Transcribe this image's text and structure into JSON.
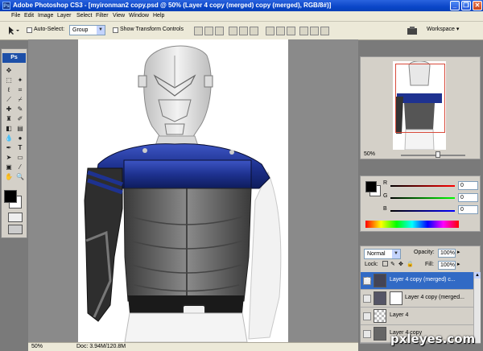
{
  "window": {
    "title": "Adobe Photoshop CS3 - [myironman2 copy.psd @ 50% (Layer 4 copy (merged) copy (merged), RGB/8#)]",
    "app_icon": "Ps",
    "minimize": "_",
    "restore": "❐",
    "close": "✕"
  },
  "menu": [
    "File",
    "Edit",
    "Image",
    "Layer",
    "Select",
    "Filter",
    "View",
    "Window",
    "Help"
  ],
  "options": {
    "auto_select_label": "Auto-Select:",
    "auto_select_value": "Group",
    "transform_label": "Show Transform Controls",
    "workspace_label": "Workspace ▾"
  },
  "toolbox": {
    "logo": "Ps",
    "icons": [
      "move-icon",
      "marquee-icon",
      "lasso-icon",
      "magic-wand-icon",
      "crop-icon",
      "slice-icon",
      "healing-icon",
      "brush-icon",
      "stamp-icon",
      "history-brush-icon",
      "eraser-icon",
      "gradient-icon",
      "blur-icon",
      "dodge-icon",
      "pen-icon",
      "type-icon",
      "path-select-icon",
      "shape-icon",
      "notes-icon",
      "eyedropper-icon",
      "hand-icon",
      "zoom-icon"
    ]
  },
  "status": {
    "zoom": "50%",
    "doc": "Doc: 3.94M/120.8M"
  },
  "navigator": {
    "zoom": "50%"
  },
  "color": {
    "r_label": "R",
    "g_label": "G",
    "b_label": "B",
    "r_value": "0",
    "g_value": "0",
    "b_value": "0",
    "foreground": "#000000",
    "background": "#ffffff"
  },
  "layers": {
    "blend_mode": "Normal",
    "opacity_label": "Opacity:",
    "opacity_value": "100%",
    "lock_label": "Lock:",
    "fill_label": "Fill:",
    "fill_value": "100%",
    "rows": [
      {
        "name": "Layer 4 copy (merged) c...",
        "selected": true,
        "visible": true
      },
      {
        "name": "Layer 4 copy (merged...",
        "selected": false,
        "visible": false
      },
      {
        "name": "Layer 4",
        "selected": false,
        "visible": false
      },
      {
        "name": "Layer 4 copy",
        "selected": false,
        "visible": false
      }
    ]
  },
  "watermark": "pxleyes.com",
  "colors": {
    "title_bar": "#0a46c8",
    "selected_layer": "#316ac5",
    "armor_blue": "#1e3290"
  }
}
